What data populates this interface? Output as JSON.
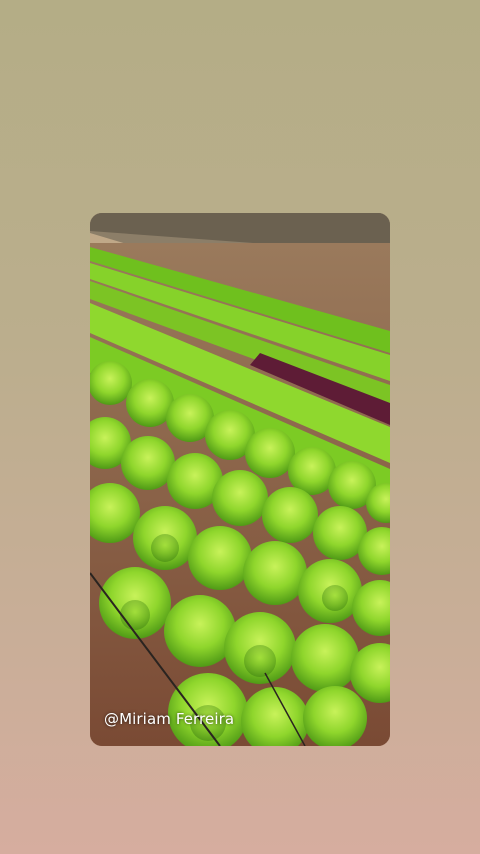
{
  "story": {
    "watermark": "@Miriam Ferreira",
    "subject": "photo of rows of green leaf lettuce with a red lettuce row on reddish soil"
  },
  "colors": {
    "background_top": "#b4ad86",
    "background_bottom": "#d6ad9f",
    "lettuce_green": "#7fd02a",
    "lettuce_red": "#6a1c3a",
    "soil": "#8b5a3c"
  }
}
